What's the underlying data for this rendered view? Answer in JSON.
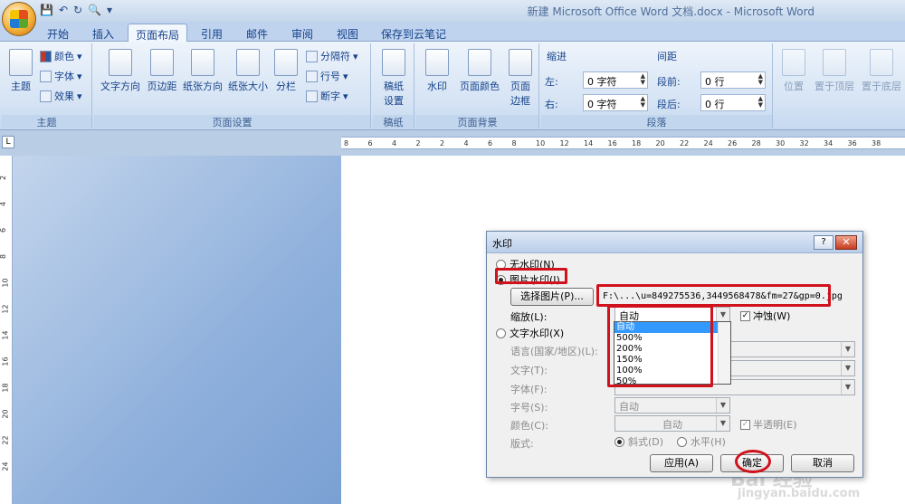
{
  "window": {
    "title": "新建 Microsoft Office Word 文档.docx - Microsoft Word"
  },
  "qat": {
    "save_icon": "save-icon",
    "undo_icon": "undo-icon",
    "redo_icon": "redo-icon",
    "preview_icon": "print-preview-icon"
  },
  "tabs": [
    "开始",
    "插入",
    "页面布局",
    "引用",
    "邮件",
    "审阅",
    "视图",
    "保存到云笔记"
  ],
  "ribbon": {
    "theme": {
      "themes": "主题",
      "colors": "颜色",
      "fonts": "字体",
      "effects": "效果",
      "label": "主题"
    },
    "page_setup": {
      "text_direction": "文字方向",
      "margins": "页边距",
      "orientation": "纸张方向",
      "size": "纸张大小",
      "columns": "分栏",
      "breaks": "分隔符",
      "line_numbers": "行号",
      "hyphenation": "断字",
      "label": "页面设置"
    },
    "manuscript": {
      "btn": "稿纸\n设置",
      "label": "稿纸"
    },
    "page_background": {
      "watermark": "水印",
      "page_color": "页面颜色",
      "page_borders": "页面\n边框",
      "label": "页面背景"
    },
    "paragraph": {
      "indent": "缩进",
      "left": "左:",
      "left_val": "0 字符",
      "right": "右:",
      "right_val": "0 字符",
      "spacing": "间距",
      "before": "段前:",
      "before_val": "0 行",
      "after": "段后:",
      "after_val": "0 行",
      "label": "段落"
    },
    "arrange": {
      "position": "位置",
      "bring_front": "置于顶层",
      "send_back": "置于底层"
    }
  },
  "ruler_ticks": [
    "8",
    "6",
    "4",
    "2",
    "2",
    "4",
    "6",
    "8",
    "10",
    "12",
    "14",
    "16",
    "18",
    "20",
    "22",
    "24",
    "26",
    "28",
    "30",
    "32",
    "34",
    "36",
    "38"
  ],
  "vruler_ticks": [
    "2",
    "4",
    "6",
    "8",
    "10",
    "12",
    "14",
    "16",
    "18",
    "20",
    "22",
    "24"
  ],
  "dialog": {
    "title": "水印",
    "help": "?",
    "close": "✕",
    "no_wm": "无水印(N)",
    "pic_wm": "图片水印(I)",
    "select_pic": "选择图片(P)...",
    "pic_path": "F:\\...\\u=849275536,3449568478&fm=27&gp=0.jpg",
    "scale_label": "缩放(L):",
    "scale_value": "自动",
    "washout": "冲蚀(W)",
    "scale_options": [
      "自动",
      "500%",
      "200%",
      "150%",
      "100%",
      "50%"
    ],
    "text_wm": "文字水印(X)",
    "language": "语言(国家/地区)(L):",
    "text": "文字(T):",
    "font": "字体(F):",
    "size": "字号(S):",
    "size_value": "自动",
    "color": "颜色(C):",
    "color_value": "自动",
    "semitransparent": "半透明(E)",
    "layout": "版式:",
    "diagonal": "斜式(D)",
    "horizontal": "水平(H)",
    "apply": "应用(A)",
    "ok": "确定",
    "cancel": "取消"
  },
  "watermark_overlay": {
    "brand": "Bai 经验",
    "url": "jingyan.baidu.com"
  }
}
